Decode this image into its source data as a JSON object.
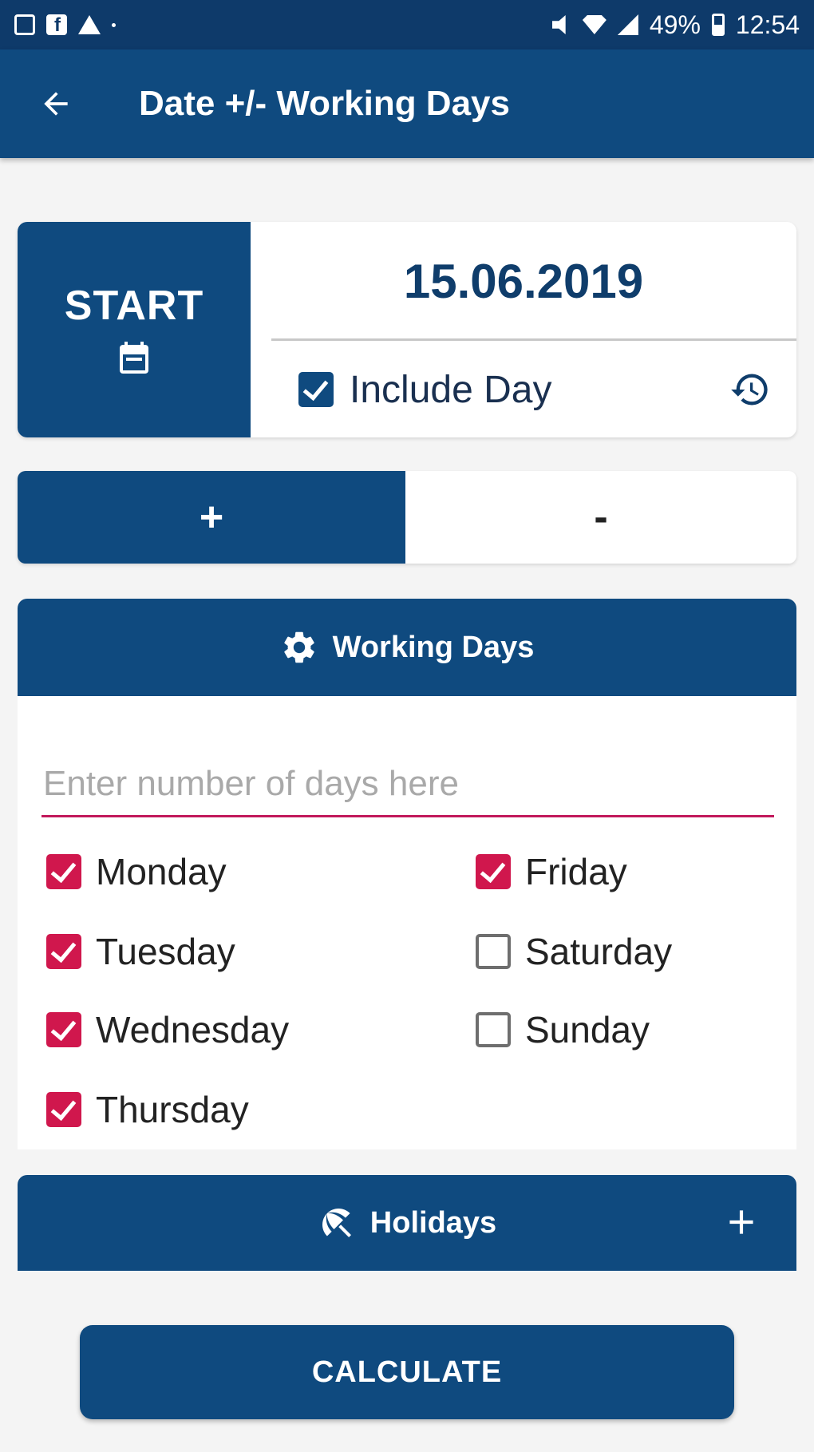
{
  "status_bar": {
    "battery": "49%",
    "time": "12:54"
  },
  "app_bar": {
    "title": "Date +/- Working Days"
  },
  "start": {
    "label": "START",
    "date": "15.06.2019",
    "include_day_label": "Include Day",
    "include_day_checked": true
  },
  "operation": {
    "plus_label": "+",
    "minus_label": "-",
    "selected": "+"
  },
  "working_days": {
    "header": "Working Days",
    "input_placeholder": "Enter number of days here",
    "input_value": "",
    "days": [
      {
        "label": "Monday",
        "checked": true
      },
      {
        "label": "Tuesday",
        "checked": true
      },
      {
        "label": "Wednesday",
        "checked": true
      },
      {
        "label": "Thursday",
        "checked": true
      },
      {
        "label": "Friday",
        "checked": true
      },
      {
        "label": "Saturday",
        "checked": false
      },
      {
        "label": "Sunday",
        "checked": false
      }
    ]
  },
  "holidays": {
    "header": "Holidays"
  },
  "calculate_label": "CALCULATE",
  "colors": {
    "primary": "#0f4a7f",
    "status_bar": "#0e3a6a",
    "accent": "#d0174d",
    "background": "#f4f4f4"
  },
  "icons": {
    "back": "arrow-left-icon",
    "calendar": "calendar-icon",
    "history": "history-icon",
    "settings": "gear-icon",
    "holidays": "umbrella-icon",
    "add": "plus-icon"
  }
}
